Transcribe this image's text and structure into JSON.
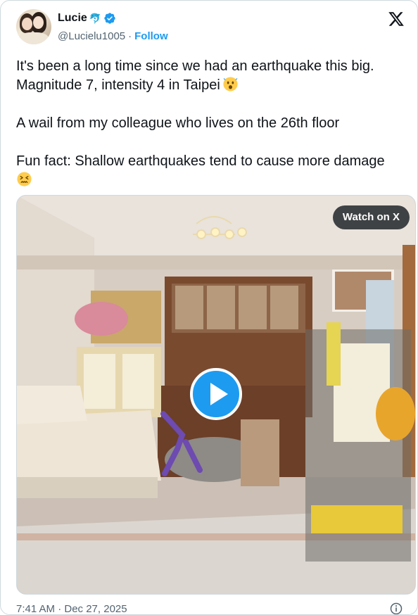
{
  "tweet": {
    "author": {
      "display_name": "Lucie",
      "name_emoji": "🐬",
      "handle": "@Lucielu1005",
      "separator": "·",
      "follow_label": "Follow",
      "verified": true
    },
    "text_lines": [
      "It's been a long time since we had an earthquake this big.",
      "Magnitude 7, intensity 4 in Taipei",
      "A wail from my colleague who lives on the 26th floor",
      "Fun fact: Shallow earthquakes tend to cause more damage"
    ],
    "emojis": [
      "astonished-face",
      "confounded-face"
    ],
    "media": {
      "type": "video",
      "watch_label": "Watch on X",
      "play_icon": "play-icon"
    },
    "timestamp": "7:41 AM · Dec 27, 2025"
  },
  "colors": {
    "accent": "#1d9bf0",
    "text": "#0f1419",
    "secondary_text": "#536471",
    "border": "#cfd9de"
  },
  "icons": {
    "brand": "x-logo-icon",
    "verified": "verified-badge-icon",
    "info": "info-icon"
  }
}
